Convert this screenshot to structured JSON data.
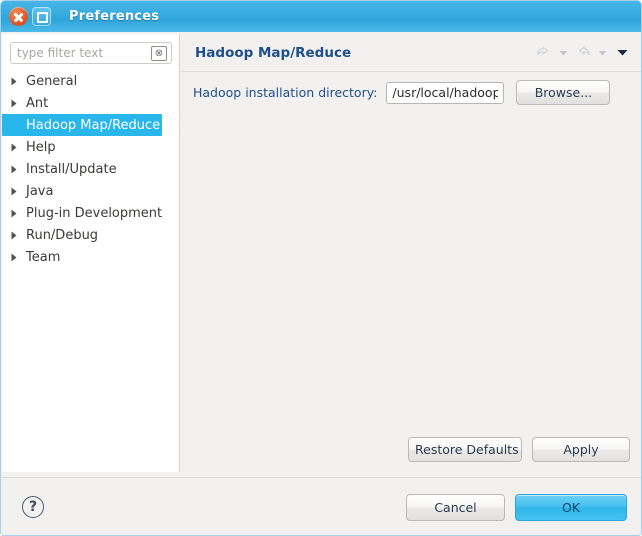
{
  "window": {
    "title": "Preferences",
    "close_icon": "close-icon",
    "maximize_icon": "maximize-icon",
    "accent_color": "#29b6ea",
    "title_text_color": "#ffffff"
  },
  "sidebar": {
    "filter": {
      "placeholder": "type filter text",
      "value": "",
      "clear_icon": "⊗"
    },
    "items": [
      {
        "label": "General",
        "expandable": true,
        "selected": false
      },
      {
        "label": "Ant",
        "expandable": true,
        "selected": false
      },
      {
        "label": "Hadoop Map/Reduce",
        "expandable": false,
        "selected": true
      },
      {
        "label": "Help",
        "expandable": true,
        "selected": false
      },
      {
        "label": "Install/Update",
        "expandable": true,
        "selected": false
      },
      {
        "label": "Java",
        "expandable": true,
        "selected": false
      },
      {
        "label": "Plug-in Development",
        "expandable": true,
        "selected": false
      },
      {
        "label": "Run/Debug",
        "expandable": true,
        "selected": false
      },
      {
        "label": "Team",
        "expandable": true,
        "selected": false
      }
    ]
  },
  "panel": {
    "title": "Hadoop Map/Reduce",
    "title_color": "#1f4e8c",
    "nav": {
      "back_icon": "back-arrow-icon",
      "back_menu_icon": "chevron-down-icon",
      "forward_icon": "forward-arrow-icon",
      "forward_menu_icon": "chevron-down-icon",
      "menu_icon": "chevron-down-icon"
    },
    "form": {
      "dir_label": "Hadoop installation directory:",
      "dir_value": "/usr/local/hadoop",
      "dir_placeholder": "",
      "browse_label": "Browse..."
    },
    "restore_label": "Restore Defaults",
    "apply_label": "Apply"
  },
  "footer": {
    "help_label": "?",
    "cancel_label": "Cancel",
    "ok_label": "OK",
    "ok_color": "#2fb5ea"
  }
}
